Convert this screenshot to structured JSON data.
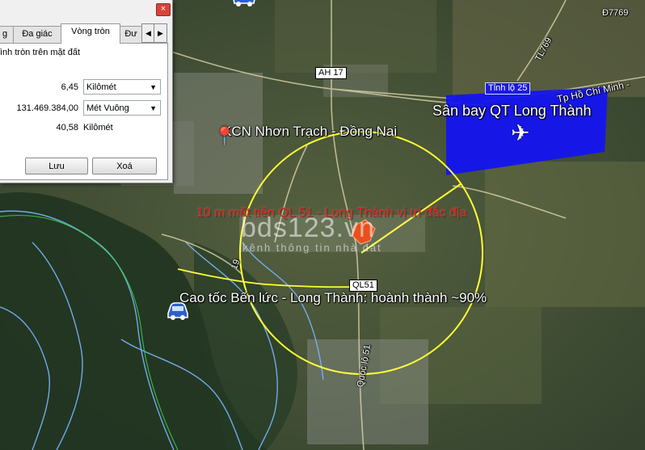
{
  "map": {
    "road_labels": {
      "ah17": "AH 17",
      "ql51_shield": "QL51",
      "quoc_lo_51": "Quốc lộ 51",
      "tinh_lo_25": "Tỉnh lộ 25",
      "tl769": "TL769",
      "d7769": "Đ7769",
      "road_19": "19",
      "tp_hcm": "Tp Hồ Chí Minh -"
    },
    "places": {
      "airport": "Sân bay QT Long Thành",
      "kcn": "KCN Nhơn Trạch - Đồng Nai",
      "expressway": "Cao tốc Bến lức - Long Thành: hoành thành ~90%",
      "site": "10 m mặt tiền QL 51 - Long Thành vị trí đắc địa"
    },
    "watermark": {
      "brand": "bds123.vn",
      "tagline": "kênh thông tin nhà đất"
    },
    "colors": {
      "circle": "#ffff33",
      "airport_zone": "#1414f0",
      "site_marker": "#e8501c",
      "rivers": "#7ab6ff"
    },
    "icons": [
      "airplane-icon",
      "car-icon",
      "placemark-pin-icon"
    ]
  },
  "dialog": {
    "tabs": [
      {
        "label": "g"
      },
      {
        "label": "Đa giác"
      },
      {
        "label": "Vòng tròn"
      },
      {
        "label": "Đư"
      }
    ],
    "active_tab": "Vòng tròn",
    "description": "ình tròn trên mặt đất",
    "radius": {
      "value": "6,45",
      "unit": "Kilômét"
    },
    "area": {
      "value": "131.469.384,00",
      "unit": "Mét Vuông"
    },
    "perimeter": {
      "value": "40,58",
      "unit": "Kilômét"
    },
    "save_label": "Lưu",
    "clear_label": "Xoá",
    "close_symbol": "×"
  }
}
